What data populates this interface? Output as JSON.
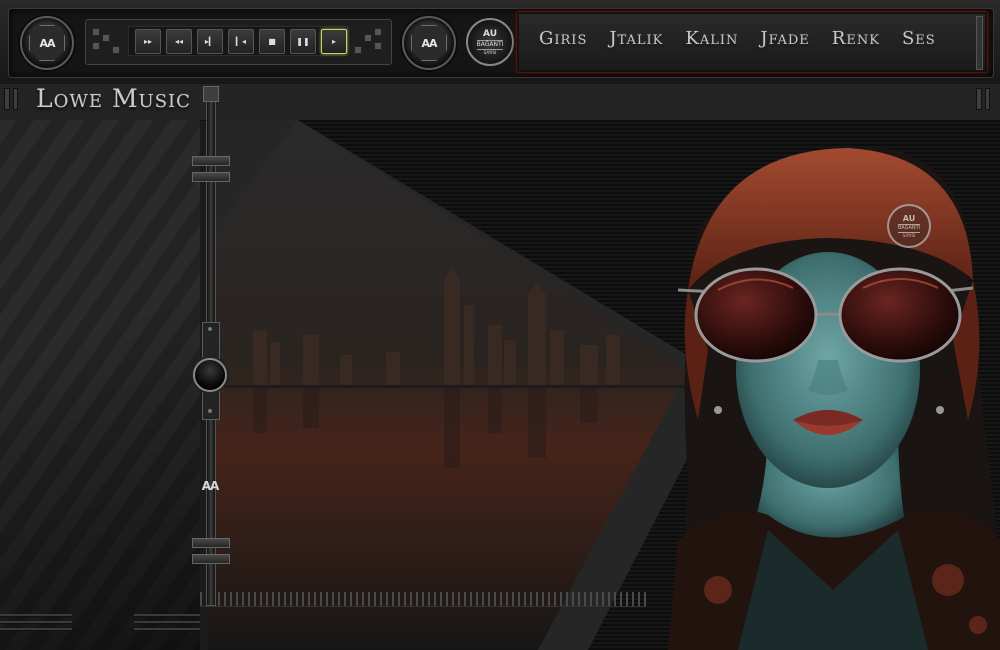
{
  "brand": {
    "title": "Lowe Music",
    "emblem_text": "AA"
  },
  "badge": {
    "line1": "AU",
    "line2": "BAĞANTI",
    "line3": "SAYISI"
  },
  "transport": {
    "buttons": [
      {
        "name": "fast-forward-icon",
        "glyph": "▸▸"
      },
      {
        "name": "rewind-icon",
        "glyph": "◂◂"
      },
      {
        "name": "next-track-icon",
        "glyph": "▸▎"
      },
      {
        "name": "previous-track-icon",
        "glyph": "▎◂"
      },
      {
        "name": "stop-icon",
        "glyph": "■"
      },
      {
        "name": "pause-icon",
        "glyph": "❚❚"
      },
      {
        "name": "play-icon",
        "glyph": "▸"
      }
    ],
    "active_button": "play-icon",
    "active_color": "#c6d36a"
  },
  "nav": {
    "links": [
      "Giris",
      "Jtalik",
      "Kalin",
      "Jfade",
      "Renk",
      "Ses"
    ]
  },
  "slider": {
    "logo_text": "AA"
  },
  "colors": {
    "accent_red": "#5a1410",
    "background": "#1b1b1b",
    "text": "#c9c9c9"
  }
}
